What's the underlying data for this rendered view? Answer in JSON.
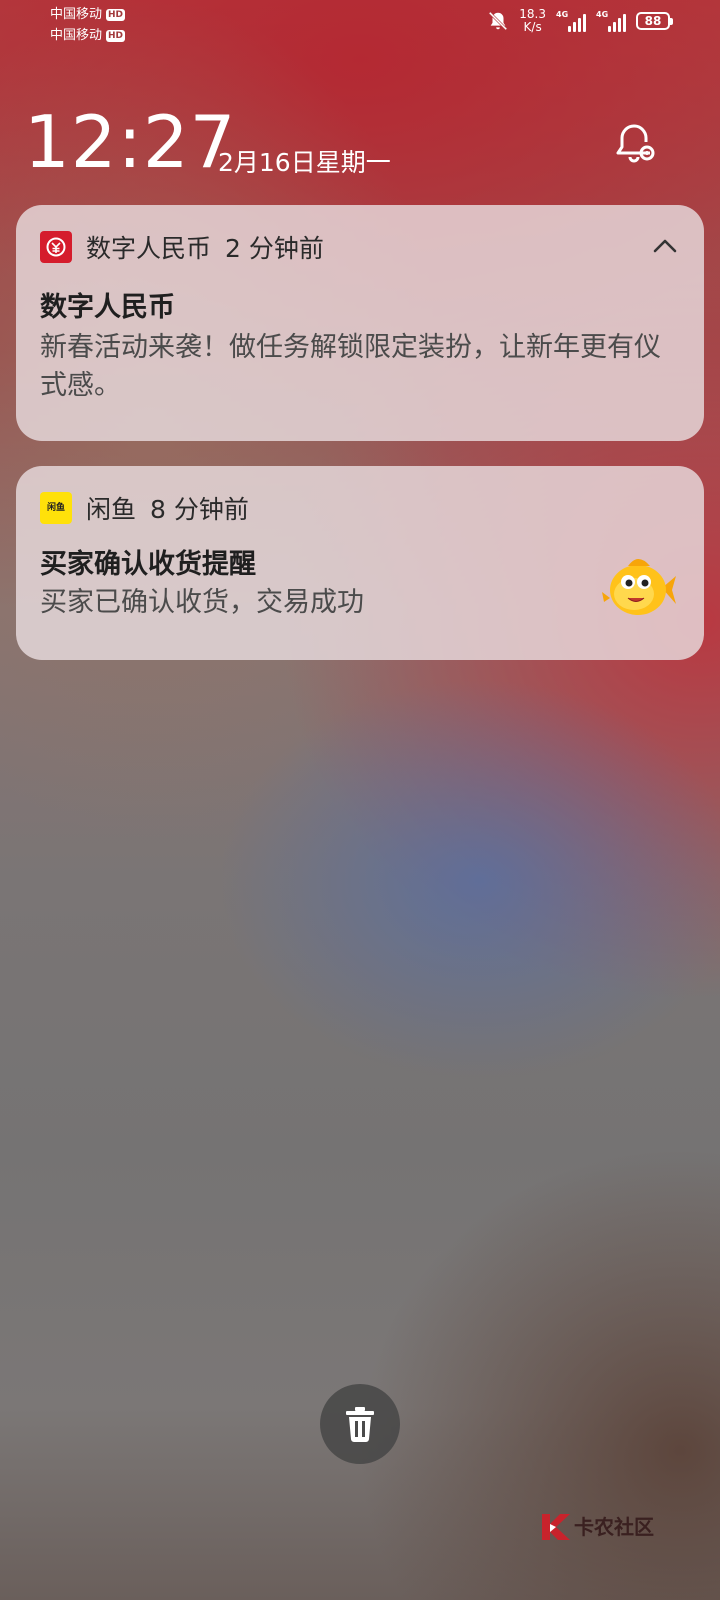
{
  "status_bar": {
    "carrier_1": "中国移动",
    "carrier_2": "中国移动",
    "hd_badge": "HD",
    "speed_value": "18.3",
    "speed_unit": "K/s",
    "network_type": "4G",
    "battery": "88"
  },
  "lockscreen": {
    "time": "12:27",
    "date": "2月16日星期一"
  },
  "notifications": [
    {
      "app_name": "数字人民币",
      "time_ago": "2 分钟前",
      "title": "数字人民币",
      "body": "新春活动来袭！做任务解锁限定装扮，让新年更有仪式感。"
    },
    {
      "app_name": "闲鱼",
      "time_ago": "8 分钟前",
      "title": "买家确认收货提醒",
      "body": "买家已确认收货，交易成功",
      "icon_text": "闲鱼"
    }
  ],
  "watermark": {
    "text": "卡农社区"
  },
  "icons": {
    "mute": "bell-off-icon",
    "settings": "bell-settings-icon",
    "collapse": "chevron-up-icon",
    "clear": "trash-icon",
    "fish": "fish-mascot-icon"
  },
  "colors": {
    "ecny_red": "#d51c2c",
    "xianyu_yellow": "#ffe10a"
  }
}
